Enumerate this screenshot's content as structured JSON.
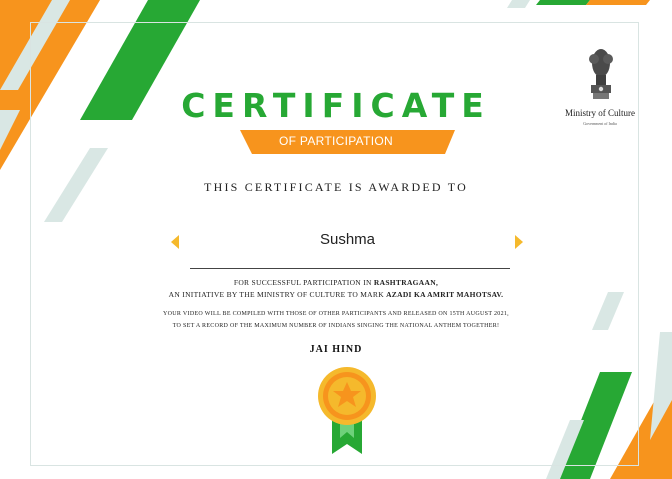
{
  "certificate": {
    "title": "CERTIFICATE",
    "subtitle": "OF PARTICIPATION",
    "awarded_to": "THIS CERTIFICATE IS AWARDED TO",
    "recipient_name": "Sushma",
    "line1_pre": "FOR SUCCESSFUL PARTICIPATION IN ",
    "line1_bold": "RASHTRAGAAN,",
    "line2_pre": "AN INITIATIVE BY THE MINISTRY OF CULTURE TO MARK ",
    "line2_bold": "AZADI KA AMRIT MAHOTSAV.",
    "line3": "YOUR VIDEO WILL BE COMPILED WITH THOSE OF OTHER PARTICIPANTS AND RELEASED ON 15TH AUGUST 2021,",
    "line4": "TO SET A RECORD OF THE MAXIMUM NUMBER OF INDIANS SINGING THE NATIONAL ANTHEM TOGETHER!",
    "closing": "JAI HIND"
  },
  "ministry": {
    "name": "Ministry of Culture",
    "government": "Government of India",
    "emblem_icon": "national-emblem-icon"
  },
  "colors": {
    "green": "#27a834",
    "saffron": "#f7941d",
    "gold": "#f5b92c",
    "light_green": "#d9e7e4"
  },
  "icons": {
    "prev": "chevron-left-icon",
    "next": "chevron-right-icon",
    "badge": "star-medal-icon"
  }
}
